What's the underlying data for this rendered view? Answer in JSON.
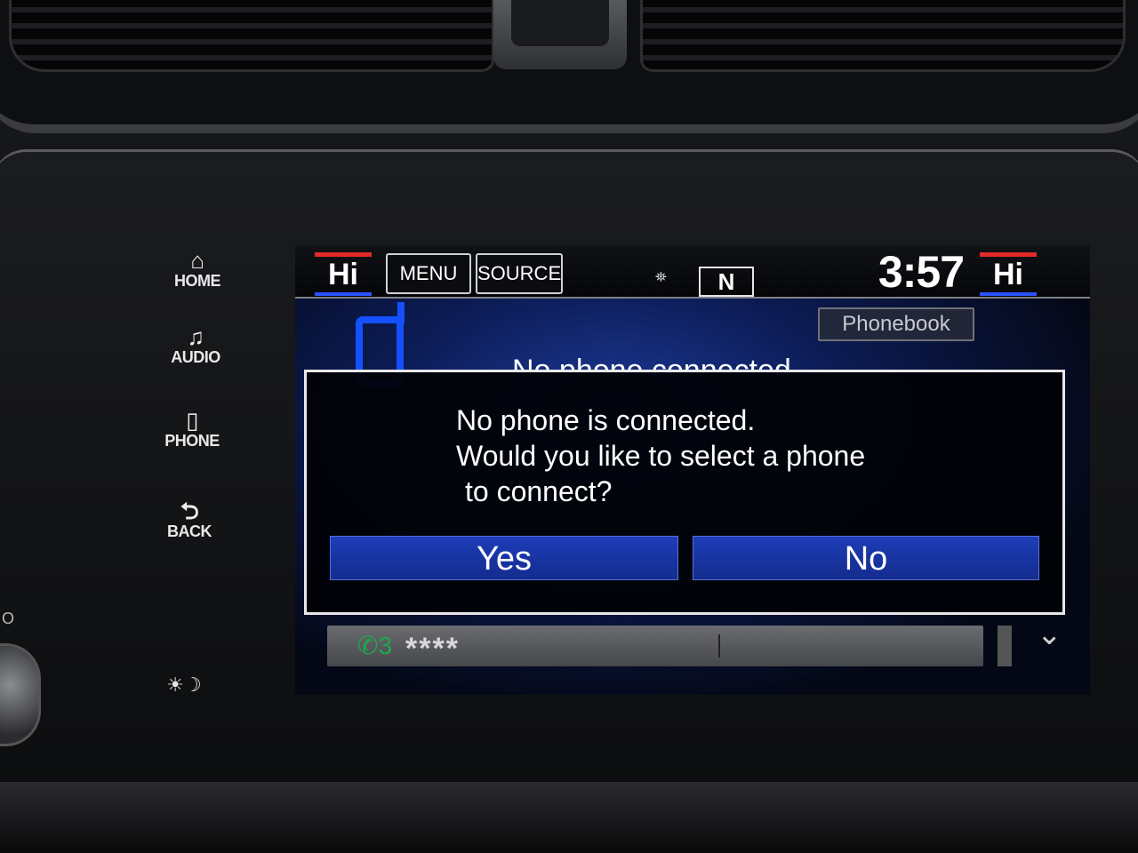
{
  "colors": {
    "temp_top": "#e42a2a",
    "temp_bottom": "#2b52ff",
    "dialog_button": "#1e3db8",
    "phone_icon": "#1450ff",
    "call_icon": "#1fa84a"
  },
  "side_buttons": {
    "home": {
      "icon": "home-icon",
      "glyph": "⌂",
      "label": "HOME"
    },
    "audio": {
      "icon": "music-note-icon",
      "glyph": "♫",
      "label": "AUDIO"
    },
    "phone": {
      "icon": "phone-icon",
      "glyph": "▯",
      "label": "PHONE"
    },
    "back": {
      "icon": "back-arrow-icon",
      "glyph": "⮌",
      "label": "BACK"
    },
    "day_night": {
      "icon": "day-night-icon",
      "glyph": "☀☽"
    },
    "knob_label": "O"
  },
  "topbar": {
    "left_temp": "Hi",
    "menu_label": "MENU",
    "source_label": "SOURCE",
    "gps_glyph": "⛯",
    "compass": "N",
    "clock": "3:57",
    "right_temp": "Hi"
  },
  "phone_screen": {
    "phonebook_label": "Phonebook",
    "status_text": "No phone connected",
    "dial_icon_glyph": "✆3",
    "dial_number": "****",
    "scroll_glyph": "⌄"
  },
  "dialog": {
    "line1": "No phone is connected.",
    "line2": "Would you like to select a phone",
    "line3": "to connect?",
    "yes_label": "Yes",
    "no_label": "No"
  }
}
